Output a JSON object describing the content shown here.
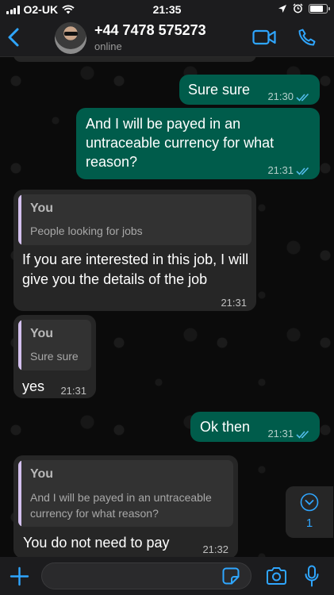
{
  "status_bar": {
    "carrier": "O2-UK",
    "time": "21:35"
  },
  "header": {
    "contact_name": "+44 7478 575273",
    "contact_status": "online"
  },
  "messages": [
    {
      "direction": "out",
      "text": "Sure sure",
      "time": "21:30"
    },
    {
      "direction": "out",
      "text": "And I will be payed in an untraceable currency for what reason?",
      "time": "21:31"
    },
    {
      "direction": "in",
      "quote_author": "You",
      "quote_text": "People looking for jobs",
      "text": "If you are interested in this job, I will give you the details of the job",
      "time": "21:31"
    },
    {
      "direction": "in",
      "quote_author": "You",
      "quote_text": "Sure sure",
      "text": "yes",
      "time": "21:31"
    },
    {
      "direction": "out",
      "text": "Ok then",
      "time": "21:31"
    },
    {
      "direction": "in",
      "quote_author": "You",
      "quote_text": "And I will be payed in an untraceable currency for what reason?",
      "text": "You do not need to pay",
      "time": "21:32"
    }
  ],
  "scroll_down": {
    "unread_count": "1"
  },
  "input": {
    "value": "",
    "placeholder": ""
  },
  "colors": {
    "outgoing_bubble": "#005c4b",
    "incoming_bubble": "#262626",
    "accent": "#2fa6ff",
    "quote_bar": "#d4c1ef"
  },
  "icons": [
    "wifi-icon",
    "location-icon",
    "alarm-icon",
    "battery-icon",
    "back-chevron-icon",
    "video-call-icon",
    "phone-icon",
    "double-check-icon",
    "chevron-down-icon",
    "plus-icon",
    "sticker-icon",
    "camera-icon",
    "microphone-icon"
  ]
}
